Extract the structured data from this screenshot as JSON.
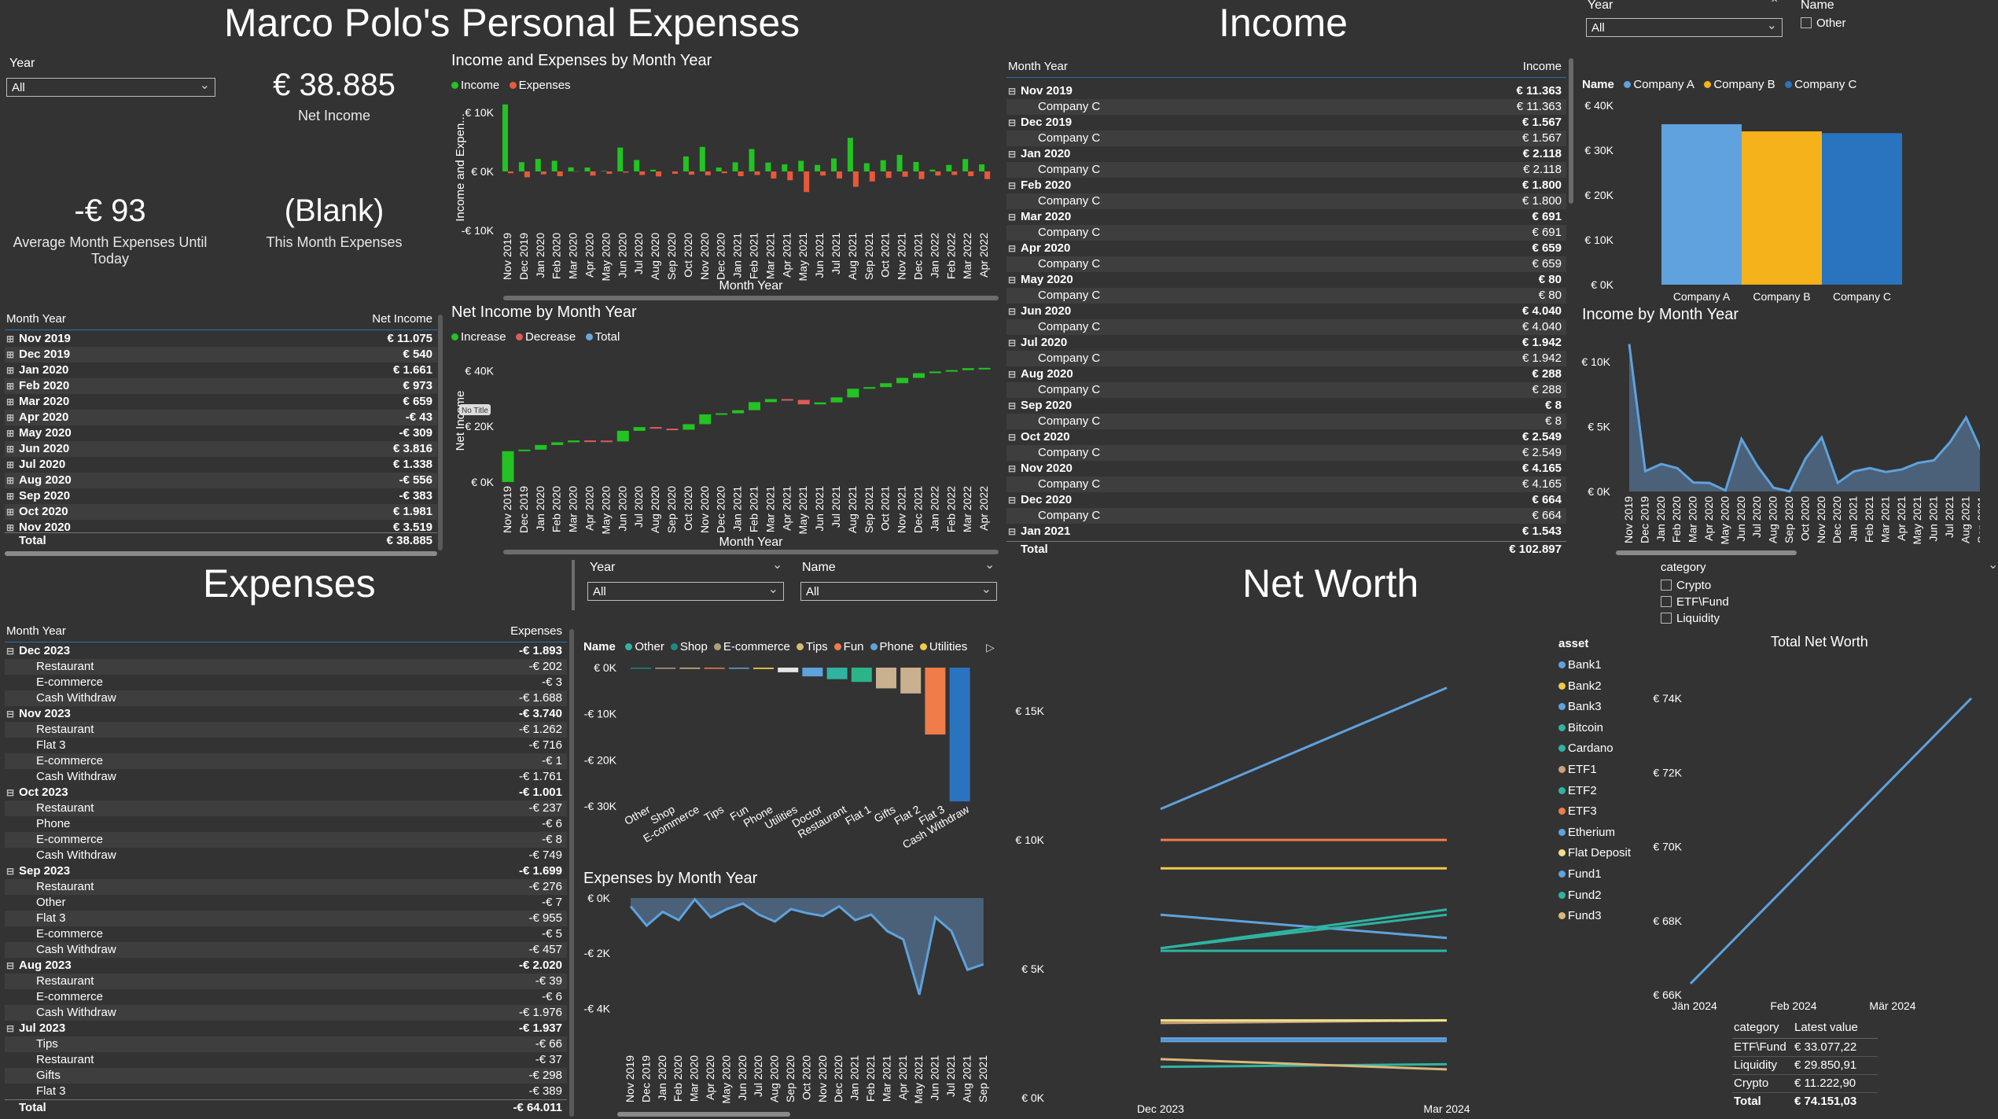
{
  "pages": {
    "personal_title": "Marco Polo's Personal Expenses",
    "income_title": "Income",
    "expenses_title": "Expenses",
    "networth_title": "Net Worth"
  },
  "filters": {
    "year_label": "Year",
    "name_label": "Name",
    "all": "All",
    "other_option": "Other",
    "category_label": "category",
    "category_options": [
      "Crypto",
      "ETF\\Fund",
      "Liquidity"
    ]
  },
  "kpis": {
    "net_income_value": "€ 38.885",
    "net_income_label": "Net Income",
    "avg_exp_value": "-€ 93",
    "avg_exp_label": "Average Month Expenses Until Today",
    "this_month_value": "(Blank)",
    "this_month_label": "This Month Expenses"
  },
  "net_income_table": {
    "col1": "Month Year",
    "col2": "Net Income",
    "rows": [
      [
        "Nov 2019",
        "€ 11.075"
      ],
      [
        "Dec 2019",
        "€ 540"
      ],
      [
        "Jan 2020",
        "€ 1.661"
      ],
      [
        "Feb 2020",
        "€ 973"
      ],
      [
        "Mar 2020",
        "€ 659"
      ],
      [
        "Apr 2020",
        "-€ 43"
      ],
      [
        "May 2020",
        "-€ 309"
      ],
      [
        "Jun 2020",
        "€ 3.816"
      ],
      [
        "Jul 2020",
        "€ 1.338"
      ],
      [
        "Aug 2020",
        "-€ 556"
      ],
      [
        "Sep 2020",
        "-€ 383"
      ],
      [
        "Oct 2020",
        "€ 1.981"
      ],
      [
        "Nov 2020",
        "€ 3.519"
      ]
    ],
    "total_label": "Total",
    "total_value": "€ 38.885"
  },
  "income_table": {
    "col1": "Month Year",
    "col2": "Income",
    "rows": [
      [
        "Nov 2019",
        "€ 11.363",
        "Company C",
        "€ 11.363"
      ],
      [
        "Dec 2019",
        "€ 1.567",
        "Company C",
        "€ 1.567"
      ],
      [
        "Jan 2020",
        "€ 2.118",
        "Company C",
        "€ 2.118"
      ],
      [
        "Feb 2020",
        "€ 1.800",
        "Company C",
        "€ 1.800"
      ],
      [
        "Mar 2020",
        "€ 691",
        "Company C",
        "€ 691"
      ],
      [
        "Apr 2020",
        "€ 659",
        "Company C",
        "€ 659"
      ],
      [
        "May 2020",
        "€ 80",
        "Company C",
        "€ 80"
      ],
      [
        "Jun 2020",
        "€ 4.040",
        "Company C",
        "€ 4.040"
      ],
      [
        "Jul 2020",
        "€ 1.942",
        "Company C",
        "€ 1.942"
      ],
      [
        "Aug 2020",
        "€ 288",
        "Company C",
        "€ 288"
      ],
      [
        "Sep 2020",
        "€ 8",
        "Company C",
        "€ 8"
      ],
      [
        "Oct 2020",
        "€ 2.549",
        "Company C",
        "€ 2.549"
      ],
      [
        "Nov 2020",
        "€ 4.165",
        "Company C",
        "€ 4.165"
      ],
      [
        "Dec 2020",
        "€ 664",
        "Company C",
        "€ 664"
      ]
    ],
    "last_row": [
      "Jan 2021",
      "€ 1.543"
    ],
    "total_label": "Total",
    "total_value": "€ 102.897"
  },
  "expenses_table": {
    "col1": "Month Year",
    "col2": "Expenses",
    "groups": [
      {
        "month": "Dec 2023",
        "value": "-€ 1.893",
        "items": [
          [
            "Restaurant",
            "-€ 202"
          ],
          [
            "E-commerce",
            "-€ 3"
          ],
          [
            "Cash Withdraw",
            "-€ 1.688"
          ]
        ]
      },
      {
        "month": "Nov 2023",
        "value": "-€ 3.740",
        "items": [
          [
            "Restaurant",
            "-€ 1.262"
          ],
          [
            "Flat 3",
            "-€ 716"
          ],
          [
            "E-commerce",
            "-€ 1"
          ],
          [
            "Cash Withdraw",
            "-€ 1.761"
          ]
        ]
      },
      {
        "month": "Oct 2023",
        "value": "-€ 1.001",
        "items": [
          [
            "Restaurant",
            "-€ 237"
          ],
          [
            "Phone",
            "-€ 6"
          ],
          [
            "E-commerce",
            "-€ 8"
          ],
          [
            "Cash Withdraw",
            "-€ 749"
          ]
        ]
      },
      {
        "month": "Sep 2023",
        "value": "-€ 1.699",
        "items": [
          [
            "Restaurant",
            "-€ 276"
          ],
          [
            "Other",
            "-€ 7"
          ],
          [
            "Flat 3",
            "-€ 955"
          ],
          [
            "E-commerce",
            "-€ 5"
          ],
          [
            "Cash Withdraw",
            "-€ 457"
          ]
        ]
      },
      {
        "month": "Aug 2023",
        "value": "-€ 2.020",
        "items": [
          [
            "Restaurant",
            "-€ 39"
          ],
          [
            "E-commerce",
            "-€ 6"
          ],
          [
            "Cash Withdraw",
            "-€ 1.976"
          ]
        ]
      },
      {
        "month": "Jul 2023",
        "value": "-€ 1.937",
        "items": [
          [
            "Tips",
            "-€ 66"
          ],
          [
            "Restaurant",
            "-€ 37"
          ],
          [
            "Gifts",
            "-€ 298"
          ],
          [
            "Flat 3",
            "-€ 389"
          ]
        ]
      }
    ],
    "total_label": "Total",
    "total_value": "-€ 64.011"
  },
  "networth_table": {
    "col1": "category",
    "col2": "Latest value",
    "rows": [
      [
        "ETF\\Fund",
        "€ 33.077,22"
      ],
      [
        "Liquidity",
        "€ 29.850,91"
      ],
      [
        "Crypto",
        "€ 11.222,90"
      ]
    ],
    "total_label": "Total",
    "total_value": "€ 74.151,03"
  },
  "chart_data": [
    {
      "id": "income_expenses_by_month",
      "type": "bar",
      "title": "Income and Expenses by Month Year",
      "xlabel": "Month Year",
      "ylabel": "Income and Expen...",
      "ylim": [
        -10000,
        12000
      ],
      "yticks": [
        "€ 10K",
        "€ 0K",
        "-€ 10K"
      ],
      "categories": [
        "Nov 2019",
        "Dec 2019",
        "Jan 2020",
        "Feb 2020",
        "Mar 2020",
        "Apr 2020",
        "May 2020",
        "Jun 2020",
        "Jul 2020",
        "Aug 2020",
        "Sep 2020",
        "Oct 2020",
        "Nov 2020",
        "Dec 2020",
        "Jan 2021",
        "Feb 2021",
        "Mar 2021",
        "Apr 2021",
        "May 2021",
        "Jun 2021",
        "Jul 2021",
        "Aug 2021",
        "Sep 2021",
        "Oct 2021",
        "Nov 2021",
        "Dec 2021",
        "Jan 2022",
        "Feb 2022",
        "Mar 2022",
        "Apr 2022"
      ],
      "series": [
        {
          "name": "Income",
          "color": "#22c322",
          "values": [
            11363,
            1567,
            2118,
            1800,
            691,
            659,
            80,
            4040,
            1942,
            288,
            8,
            2549,
            4165,
            664,
            1543,
            3800,
            1500,
            1200,
            1800,
            1100,
            2200,
            5700,
            1400,
            1900,
            2800,
            1600,
            300,
            1100,
            2100,
            1200
          ]
        },
        {
          "name": "Expenses",
          "color": "#e8583a",
          "values": [
            -300,
            -1000,
            -500,
            -800,
            -50,
            -700,
            -400,
            -200,
            -600,
            -850,
            -400,
            -550,
            -650,
            -300,
            -800,
            -600,
            -1200,
            -1500,
            -3500,
            -700,
            -1200,
            -2600,
            -1700,
            -1100,
            -900,
            -1300,
            -700,
            -600,
            -800,
            -1300
          ]
        }
      ]
    },
    {
      "id": "net_income_by_month",
      "type": "waterfall",
      "title": "Net Income by Month Year",
      "xlabel": "Month Year",
      "ylabel": "Net Income",
      "ylim": [
        -2000,
        46000
      ],
      "yticks": [
        "€ 40K",
        "€ 20K",
        "€ 0K"
      ],
      "tooltip": "No Title",
      "legend": [
        {
          "name": "Increase",
          "color": "#22c322"
        },
        {
          "name": "Decrease",
          "color": "#e05a5a"
        },
        {
          "name": "Total",
          "color": "#6ea6d8"
        }
      ],
      "categories": [
        "Nov 2019",
        "Dec 2019",
        "Jan 2020",
        "Feb 2020",
        "Mar 2020",
        "Apr 2020",
        "May 2020",
        "Jun 2020",
        "Jul 2020",
        "Aug 2020",
        "Sep 2020",
        "Oct 2020",
        "Nov 2020",
        "Dec 2020",
        "Jan 2021",
        "Feb 2021",
        "Mar 2021",
        "Apr 2021",
        "May 2021",
        "Jun 2021",
        "Jul 2021",
        "Aug 2021",
        "Sep 2021",
        "Oct 2021",
        "Nov 2021",
        "Dec 2021",
        "Jan 2022",
        "Feb 2022",
        "Mar 2022",
        "Apr 2022"
      ],
      "values": [
        11075,
        540,
        1661,
        973,
        659,
        -43,
        -309,
        3816,
        1338,
        -556,
        -383,
        1981,
        3519,
        400,
        1100,
        2900,
        1100,
        -300,
        -1600,
        700,
        1800,
        3100,
        600,
        1400,
        1900,
        1700,
        600,
        500,
        700,
        100
      ]
    },
    {
      "id": "income_by_company",
      "type": "bar",
      "legend_title": "Name",
      "yticks": [
        "€ 40K",
        "€ 30K",
        "€ 20K",
        "€ 10K",
        "€ 0K"
      ],
      "ylim": [
        0,
        40000
      ],
      "categories": [
        "Company A",
        "Company B",
        "Company C"
      ],
      "colors": [
        "#5fa2dd",
        "#f5b21a",
        "#2a73bf"
      ],
      "values": [
        35800,
        34200,
        33800
      ]
    },
    {
      "id": "income_by_month",
      "type": "area",
      "title": "Income by Month Year",
      "yticks": [
        "€ 10K",
        "€ 5K",
        "€ 0K"
      ],
      "ylim": [
        0,
        12000
      ],
      "categories": [
        "Nov 2019",
        "Dec 2019",
        "Jan 2020",
        "Feb 2020",
        "Mar 2020",
        "Apr 2020",
        "May 2020",
        "Jun 2020",
        "Jul 2020",
        "Aug 2020",
        "Sep 2020",
        "Oct 2020",
        "Nov 2020",
        "Dec 2020",
        "Jan 2021",
        "Feb 2021",
        "Mar 2021",
        "Apr 2021",
        "May 2021",
        "Jun 2021",
        "Jul 2021",
        "Aug 2021",
        "Sep 2021"
      ],
      "values": [
        11363,
        1567,
        2118,
        1800,
        691,
        659,
        80,
        4040,
        1942,
        288,
        8,
        2549,
        4165,
        664,
        1543,
        1800,
        1500,
        1700,
        2200,
        2400,
        3800,
        5700,
        3000
      ],
      "color": "#5fa2dd"
    },
    {
      "id": "expenses_by_category",
      "type": "bar",
      "legend_title": "Name",
      "legend": [
        {
          "name": "Other",
          "color": "#2fb3a2"
        },
        {
          "name": "Shop",
          "color": "#1e8a84"
        },
        {
          "name": "E-commerce",
          "color": "#b0a07a"
        },
        {
          "name": "Tips",
          "color": "#d9b87c"
        },
        {
          "name": "Fun",
          "color": "#f07c4a"
        },
        {
          "name": "Phone",
          "color": "#5fa2dd"
        },
        {
          "name": "Utilities",
          "color": "#f0c94a"
        }
      ],
      "yticks": [
        "€ 0K",
        "-€ 10K",
        "-€ 20K",
        "-€ 30K"
      ],
      "ylim": [
        -30000,
        0
      ],
      "categories": [
        "Other",
        "Shop",
        "E-commerce",
        "Tips",
        "Fun",
        "Phone",
        "Utilities",
        "Doctor",
        "Restaurant",
        "Flat 1",
        "Gifts",
        "Flat 2",
        "Flat 3",
        "Cash Withdraw"
      ],
      "colors": [
        "#2fb3a2",
        "#1e8a84",
        "#b0a07a",
        "#d9b87c",
        "#f07c4a",
        "#5fa2dd",
        "#f0c94a",
        "#e5e5e5",
        "#5fa2dd",
        "#2fb3a2",
        "#2bb38a",
        "#c9b08f",
        "#c9b08f",
        "#f07c4a",
        "#2a73bf"
      ],
      "values": [
        -50,
        -100,
        -150,
        -200,
        -250,
        -300,
        -1000,
        -1900,
        -2500,
        -3100,
        -4500,
        -5600,
        -14500,
        -29000
      ]
    },
    {
      "id": "expenses_by_month",
      "type": "area",
      "title": "Expenses by Month Year",
      "yticks": [
        "€ 0K",
        "-€ 2K",
        "-€ 4K"
      ],
      "ylim": [
        -4500,
        0
      ],
      "categories": [
        "Nov 2019",
        "Dec 2019",
        "Jan 2020",
        "Feb 2020",
        "Mar 2020",
        "Apr 2020",
        "May 2020",
        "Jun 2020",
        "Jul 2020",
        "Aug 2020",
        "Sep 2020",
        "Oct 2020",
        "Nov 2020",
        "Dec 2020",
        "Jan 2021",
        "Feb 2021",
        "Mar 2021",
        "Apr 2021",
        "May 2021",
        "Jun 2021",
        "Jul 2021",
        "Aug 2021",
        "Sep 2021"
      ],
      "values": [
        -300,
        -1000,
        -500,
        -800,
        -50,
        -700,
        -400,
        -200,
        -600,
        -850,
        -400,
        -550,
        -650,
        -300,
        -800,
        -600,
        -1200,
        -1500,
        -3500,
        -700,
        -1200,
        -2600,
        -2400
      ],
      "color": "#5fa2dd"
    },
    {
      "id": "net_worth_by_asset",
      "type": "line",
      "legend_title": "asset",
      "yticks": [
        "€ 15K",
        "€ 10K",
        "€ 5K",
        "€ 0K"
      ],
      "ylim": [
        0,
        16500
      ],
      "x": [
        "Dec 2023",
        "Mar 2024"
      ],
      "series": [
        {
          "name": "Bank1",
          "color": "#5fa2dd",
          "values": [
            11200,
            15900
          ]
        },
        {
          "name": "Bank2",
          "color": "#f0c94a",
          "values": [
            8900,
            8900
          ]
        },
        {
          "name": "Bank3",
          "color": "#5fa2dd",
          "values": [
            7100,
            6200
          ]
        },
        {
          "name": "Bitcoin",
          "color": "#2fb3a2",
          "values": [
            5700,
            5700
          ]
        },
        {
          "name": "Cardano",
          "color": "#2fb3a2",
          "values": [
            5800,
            7300
          ]
        },
        {
          "name": "ETF1",
          "color": "#c9a07a",
          "values": [
            2900,
            3000
          ]
        },
        {
          "name": "ETF2",
          "color": "#2fb3a2",
          "values": [
            1200,
            1300
          ]
        },
        {
          "name": "ETF3",
          "color": "#f07c4a",
          "values": [
            10000,
            10000
          ]
        },
        {
          "name": "Etherium",
          "color": "#5fa2dd",
          "values": [
            2300,
            2300
          ]
        },
        {
          "name": "Flat Deposit",
          "color": "#f0e08a",
          "values": [
            3000,
            3000
          ]
        },
        {
          "name": "Fund1",
          "color": "#5fa2dd",
          "values": [
            2200,
            2200
          ]
        },
        {
          "name": "Fund2",
          "color": "#2fb3a2",
          "values": [
            5800,
            7100
          ]
        },
        {
          "name": "Fund3",
          "color": "#d9b87c",
          "values": [
            1500,
            1100
          ]
        }
      ]
    },
    {
      "id": "total_net_worth",
      "type": "line",
      "title": "Total Net Worth",
      "yticks": [
        "€ 74K",
        "€ 72K",
        "€ 70K",
        "€ 68K",
        "€ 66K"
      ],
      "ylim": [
        66000,
        74000
      ],
      "xticks": [
        "Jän 2024",
        "Feb 2024",
        "Mär 2024"
      ],
      "x": [
        0,
        3
      ],
      "values": [
        66300,
        74000
      ],
      "color": "#5fa2dd"
    }
  ]
}
